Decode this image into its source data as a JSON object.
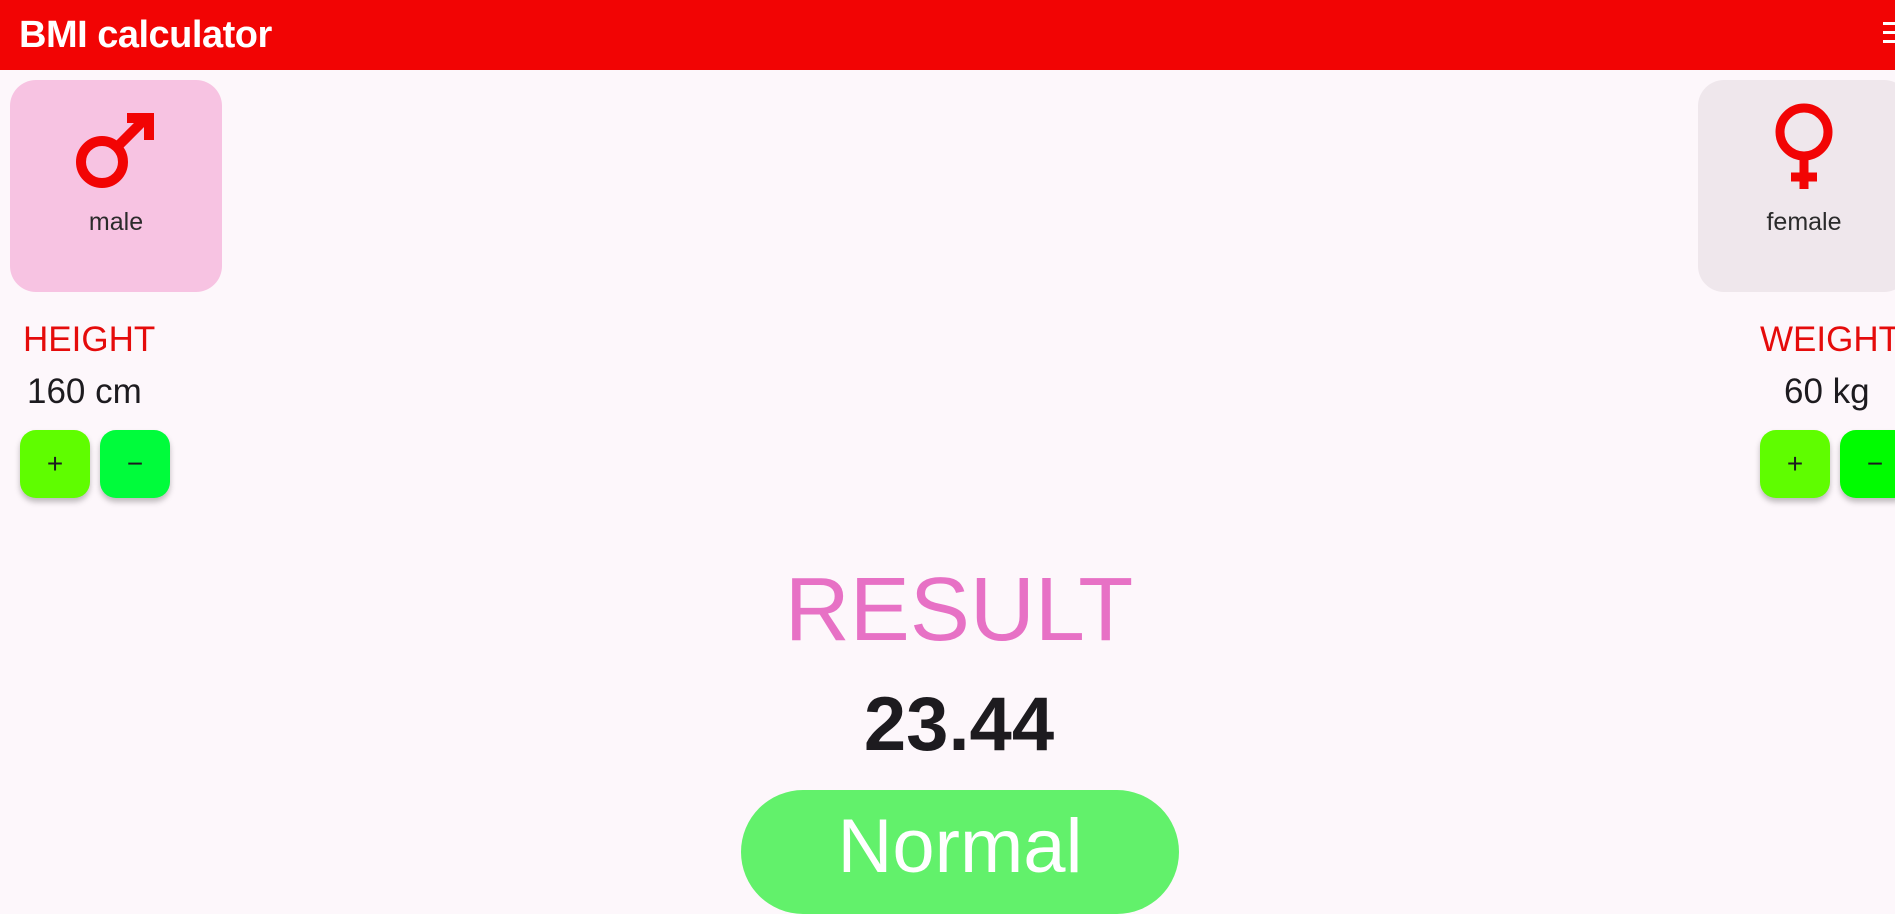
{
  "app_bar": {
    "title": "BMI calculator",
    "background_color": "#f20404",
    "menu_icon": "hamburger-menu-icon"
  },
  "gender": {
    "male": {
      "label": "male",
      "icon": "male-symbol-icon",
      "card_color": "#f7c3e2"
    },
    "female": {
      "label": "female",
      "icon": "female-symbol-icon",
      "card_color": "#efe7ec"
    },
    "icon_color": "#f20404"
  },
  "height": {
    "label": "HEIGHT",
    "value": "160 cm",
    "increment_label": "+",
    "decrement_label": "−",
    "increment_color": "#5ffd00",
    "decrement_color": "#00fc3b"
  },
  "weight": {
    "label": "WEIGHT",
    "value": "60 kg",
    "increment_label": "+",
    "decrement_label": "−",
    "increment_color": "#5ffd00",
    "decrement_color": "#00fc00"
  },
  "result": {
    "title": "RESULT",
    "value": "23.44",
    "status": "Normal",
    "title_color": "#e771c5",
    "status_color": "#62f16b"
  }
}
